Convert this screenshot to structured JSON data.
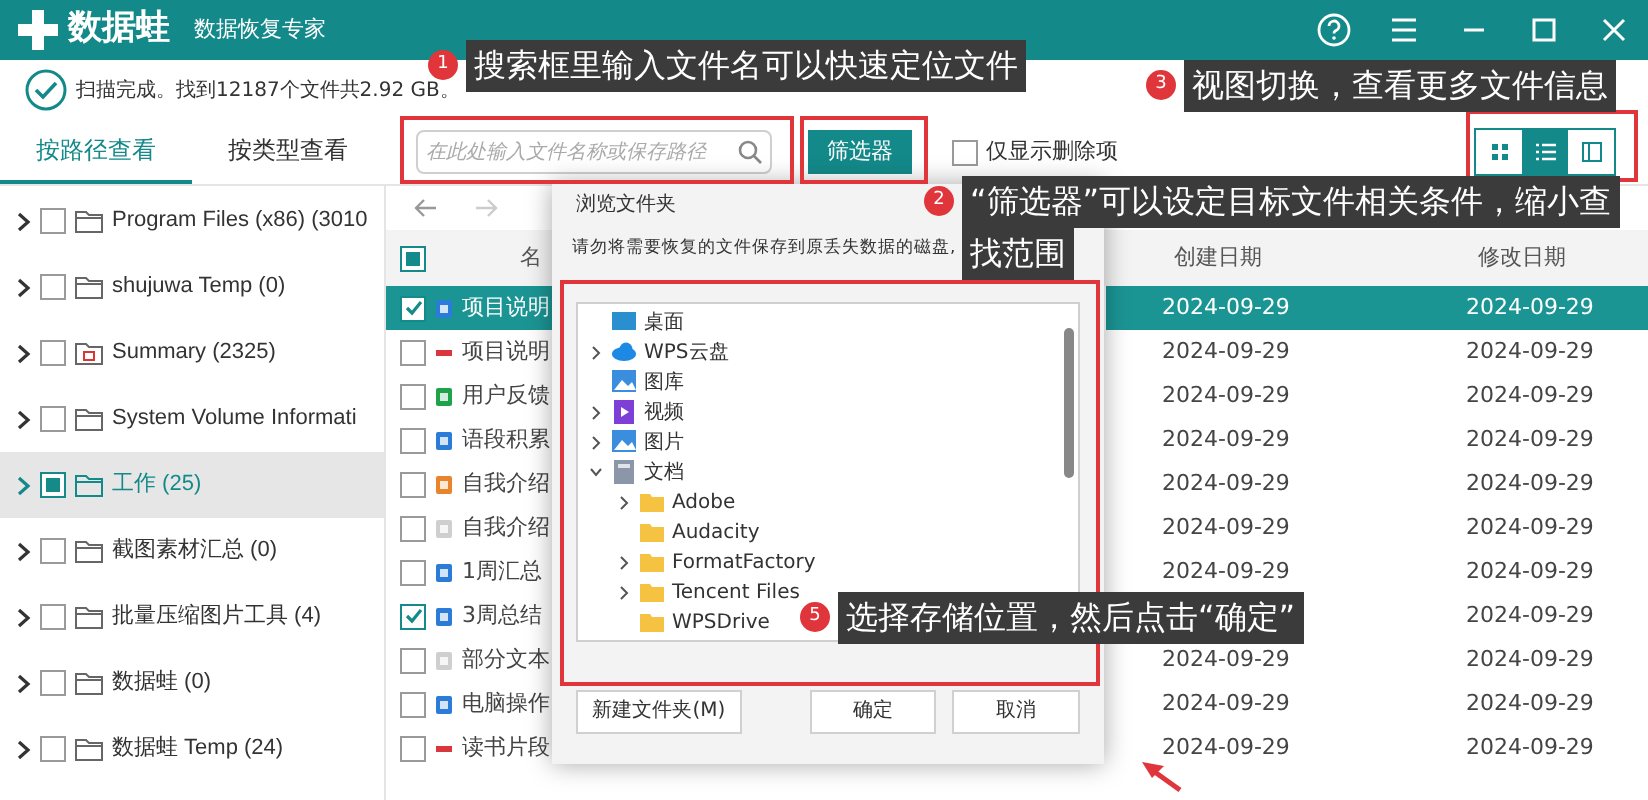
{
  "app": {
    "name": "数据蛙",
    "subtitle": "数据恢复专家"
  },
  "status": {
    "text": "扫描完成。找到12187个文件共2.92 GB。"
  },
  "tabs": [
    {
      "label": "按路径查看",
      "selected": true
    },
    {
      "label": "按类型查看",
      "selected": false
    }
  ],
  "search": {
    "placeholder": "在此处输入文件名称或保存路径"
  },
  "filter_button": "筛选器",
  "deleted_only": {
    "label": "仅显示删除项",
    "checked": false
  },
  "views": [
    {
      "kind": "grid",
      "selected": false
    },
    {
      "kind": "list",
      "selected": true
    },
    {
      "kind": "detail",
      "selected": false
    }
  ],
  "tree": [
    {
      "label": "Program Files (x86) (3010",
      "kind": "folder",
      "checked": false,
      "selected": false
    },
    {
      "label": "shujuwa Temp (0)",
      "kind": "folder",
      "checked": false,
      "selected": false
    },
    {
      "label": "Summary (2325)",
      "kind": "special",
      "checked": false,
      "selected": false
    },
    {
      "label": "System Volume Informati",
      "kind": "folder",
      "checked": false,
      "selected": false
    },
    {
      "label": "工作 (25)",
      "kind": "folder",
      "checked": true,
      "selected": true
    },
    {
      "label": "截图素材汇总 (0)",
      "kind": "folder",
      "checked": false,
      "selected": false
    },
    {
      "label": "批量压缩图片工具 (4)",
      "kind": "folder",
      "checked": false,
      "selected": false
    },
    {
      "label": "数据蛙 (0)",
      "kind": "folder",
      "checked": false,
      "selected": false
    },
    {
      "label": "数据蛙 Temp (24)",
      "kind": "folder",
      "checked": false,
      "selected": false
    }
  ],
  "table": {
    "columns": [
      "名",
      "创建日期",
      "修改日期"
    ],
    "header_checked": true,
    "rows": [
      {
        "name": "项目说明",
        "kind": "doc",
        "checked": true,
        "selected": true,
        "created": "2024-09-29",
        "modified": "2024-09-29"
      },
      {
        "name": "项目说明",
        "kind": "pdf",
        "checked": false,
        "selected": false,
        "created": "2024-09-29",
        "modified": "2024-09-29"
      },
      {
        "name": "用户反馈",
        "kind": "xls",
        "checked": false,
        "selected": false,
        "created": "2024-09-29",
        "modified": "2024-09-29"
      },
      {
        "name": "语段积累",
        "kind": "doc",
        "checked": false,
        "selected": false,
        "created": "2024-09-29",
        "modified": "2024-09-29"
      },
      {
        "name": "自我介绍",
        "kind": "ppt",
        "checked": false,
        "selected": false,
        "created": "2024-09-29",
        "modified": "2024-09-29"
      },
      {
        "name": "自我介绍",
        "kind": "txt",
        "checked": false,
        "selected": false,
        "created": "2024-09-29",
        "modified": "2024-09-29"
      },
      {
        "name": "1周汇总",
        "kind": "doc",
        "checked": false,
        "selected": false,
        "created": "2024-09-29",
        "modified": "2024-09-29"
      },
      {
        "name": "3周总结",
        "kind": "doc",
        "checked": true,
        "selected": false,
        "modified": "2024-09-29"
      },
      {
        "name": "部分文本",
        "kind": "txt",
        "checked": false,
        "selected": false,
        "created": "2024-09-29",
        "modified": "2024-09-29"
      },
      {
        "name": "电脑操作",
        "kind": "doc",
        "checked": false,
        "selected": false,
        "created": "2024-09-29",
        "modified": "2024-09-29"
      },
      {
        "name": "读书片段",
        "kind": "pdf",
        "checked": false,
        "selected": false,
        "created": "2024-09-29",
        "modified": "2024-09-29"
      }
    ]
  },
  "dialog": {
    "title": "浏览文件夹",
    "message": "请勿将需要恢复的文件保存到原丢失数据的磁盘,",
    "tree": [
      {
        "label": "桌面",
        "kind": "desktop",
        "expandable": false
      },
      {
        "label": "WPS云盘",
        "kind": "cloud",
        "expandable": true
      },
      {
        "label": "图库",
        "kind": "gallery",
        "expandable": false
      },
      {
        "label": "视频",
        "kind": "video",
        "expandable": true
      },
      {
        "label": "图片",
        "kind": "gallery",
        "expandable": true
      },
      {
        "label": "文档",
        "kind": "docs",
        "expandable": true,
        "expanded": true,
        "children": [
          {
            "label": "Adobe",
            "kind": "folder",
            "expandable": true
          },
          {
            "label": "Audacity",
            "kind": "folder",
            "expandable": false
          },
          {
            "label": "FormatFactory",
            "kind": "folder",
            "expandable": true
          },
          {
            "label": "Tencent Files",
            "kind": "folder",
            "expandable": true
          },
          {
            "label": "WPSDrive",
            "kind": "folder",
            "expandable": false
          }
        ]
      }
    ],
    "buttons": [
      "新建文件夹(M)",
      "确定",
      "取消"
    ]
  },
  "annotations": [
    {
      "number": "1",
      "lines": [
        "搜索框里输入文件名可以快速定位文件"
      ]
    },
    {
      "number": "3",
      "lines": [
        "视图切换，查看更多文件信息"
      ]
    },
    {
      "number": "2",
      "lines": [
        "“筛选器”可以设定目标文件相关条件，缩小查",
        "找范围"
      ]
    },
    {
      "number": "5",
      "lines": [
        "选择存储位置，然后点击“确定”"
      ]
    }
  ]
}
